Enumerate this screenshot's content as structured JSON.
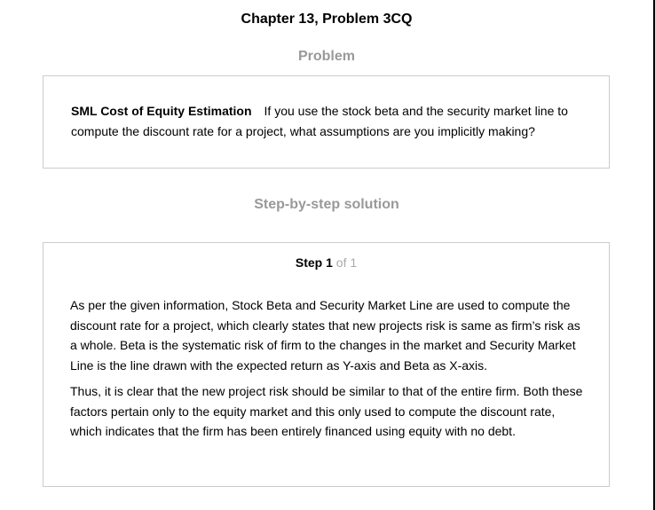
{
  "chapter_title": "Chapter 13, Problem 3CQ",
  "problem": {
    "heading": "Problem",
    "topic": "SML Cost of Equity Estimation",
    "text": "If you use the stock beta and the security market line to compute the discount rate for a project, what assumptions are you implicitly making?"
  },
  "solution": {
    "heading": "Step-by-step solution",
    "step_word": "Step",
    "step_number": "1",
    "step_of": "of 1",
    "paragraphs": [
      "As per the given information, Stock Beta and Security Market Line are used to compute the discount rate for a project, which clearly states that new projects risk is same as firm’s risk as a whole. Beta is the systematic risk of firm to the changes in the market and Security Market Line is the line drawn with the expected return as Y-axis and Beta as X-axis.",
      "Thus, it is clear that the new project risk should be similar to that of the entire firm. Both these factors pertain only to the equity market and this only used to compute the discount rate, which indicates that the firm has been entirely financed using equity with no debt."
    ]
  }
}
